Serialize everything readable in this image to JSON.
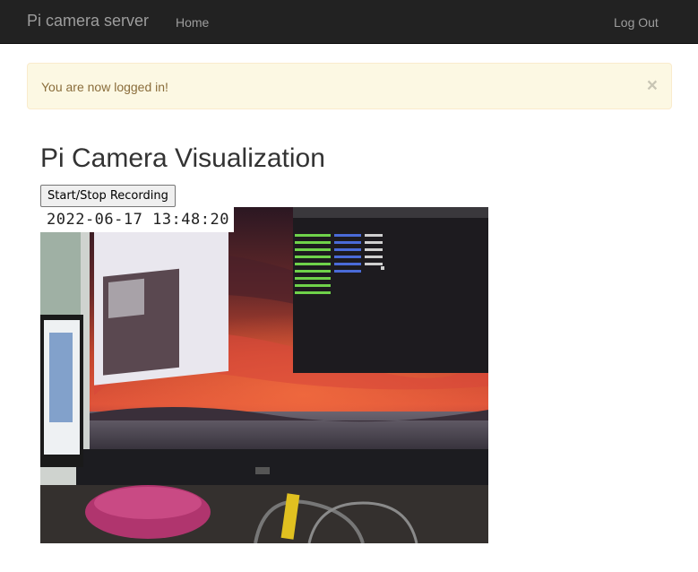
{
  "navbar": {
    "brand": "Pi camera server",
    "home_label": "Home",
    "logout_label": "Log Out"
  },
  "alert": {
    "message": "You are now logged in!",
    "close_glyph": "×"
  },
  "main": {
    "title": "Pi Camera Visualization",
    "record_button_label": "Start/Stop Recording",
    "camera": {
      "timestamp": "2022-06-17 13:48:20"
    }
  }
}
